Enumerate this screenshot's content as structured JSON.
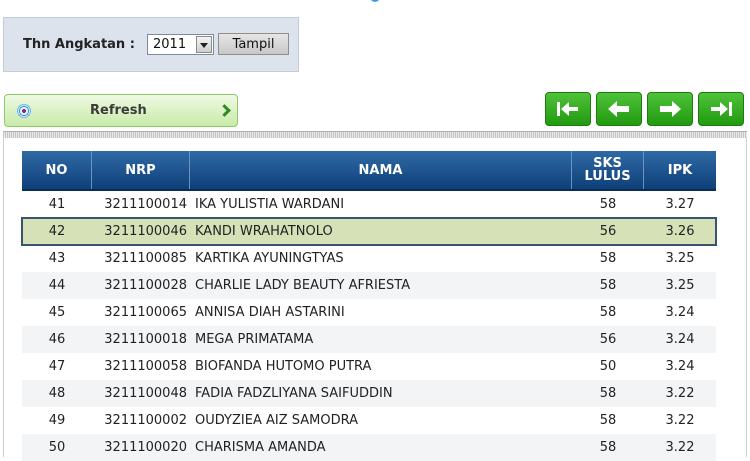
{
  "filter": {
    "label": "Thn Angkatan :",
    "year_value": "2011",
    "button_label": "Tampil"
  },
  "refresh": {
    "label": "Refresh"
  },
  "nav": [
    "first-page",
    "previous-page",
    "next-page",
    "last-page"
  ],
  "table": {
    "headers": {
      "no": "NO",
      "nrp": "NRP",
      "nama": "NAMA",
      "sks": "SKS LULUS",
      "ipk": "IPK"
    },
    "rows": [
      {
        "no": "41",
        "nrp": "3211100014",
        "nama": "IKA YULISTIA WARDANI",
        "sks": "58",
        "ipk": "3.27"
      },
      {
        "no": "42",
        "nrp": "3211100046",
        "nama": "KANDI WRAHATNOLO",
        "sks": "56",
        "ipk": "3.26"
      },
      {
        "no": "43",
        "nrp": "3211100085",
        "nama": "KARTIKA AYUNINGTYAS",
        "sks": "58",
        "ipk": "3.25"
      },
      {
        "no": "44",
        "nrp": "3211100028",
        "nama": "CHARLIE LADY BEAUTY AFRIESTA",
        "sks": "58",
        "ipk": "3.25"
      },
      {
        "no": "45",
        "nrp": "3211100065",
        "nama": "ANNISA DIAH ASTARINI",
        "sks": "58",
        "ipk": "3.24"
      },
      {
        "no": "46",
        "nrp": "3211100018",
        "nama": "MEGA PRIMATAMA",
        "sks": "56",
        "ipk": "3.24"
      },
      {
        "no": "47",
        "nrp": "3211100058",
        "nama": "BIOFANDA HUTOMO PUTRA",
        "sks": "50",
        "ipk": "3.24"
      },
      {
        "no": "48",
        "nrp": "3211100048",
        "nama": "FADIA FADZLIYANA SAIFUDDIN",
        "sks": "58",
        "ipk": "3.22"
      },
      {
        "no": "49",
        "nrp": "3211100002",
        "nama": "OUDYZIEA AIZ SAMODRA",
        "sks": "58",
        "ipk": "3.22"
      },
      {
        "no": "50",
        "nrp": "3211100020",
        "nama": "CHARISMA AMANDA",
        "sks": "58",
        "ipk": "3.22"
      }
    ]
  },
  "colors": {
    "header_bg": "#1d5290",
    "selected_row": "#d6e1b8",
    "nav_button": "#2fae1c",
    "refresh_bg": "#d9f1c2"
  }
}
